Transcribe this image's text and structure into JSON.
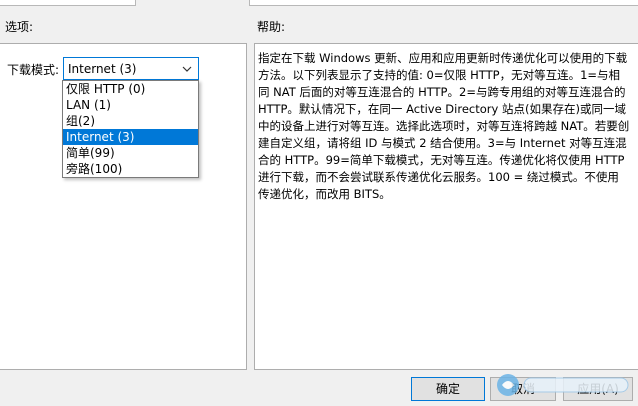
{
  "options_label": "选项:",
  "help_label": "帮助:",
  "download_mode": {
    "label": "下载模式:",
    "selected": "Internet (3)",
    "options": [
      "仅限 HTTP (0)",
      "LAN (1)",
      "组(2)",
      "Internet (3)",
      "简单(99)",
      "旁路(100)"
    ]
  },
  "help_text": "指定在下载 Windows 更新、应用和应用更新时传递优化可以使用的下载方法。以下列表显示了支持的值: 0=仅限 HTTP，无对等互连。1=与相同 NAT 后面的对等互连混合的 HTTP。2=与跨专用组的对等互连混合的 HTTP。默认情况下，在同一 Active Directory 站点(如果存在)或同一域中的设备上进行对等互连。选择此选项时，对等互连将跨越 NAT。若要创建自定义组，请将组 ID 与模式 2 结合使用。3=与 Internet 对等互连混合的 HTTP。99=简单下载模式，无对等互连。传递优化将仅使用 HTTP 进行下载，而不会尝试联系传递优化云服务。100 = 绕过模式。不使用传递优化，而改用 BITS。",
  "buttons": {
    "ok": "确定",
    "cancel": "取消",
    "apply": "应用(A)"
  }
}
